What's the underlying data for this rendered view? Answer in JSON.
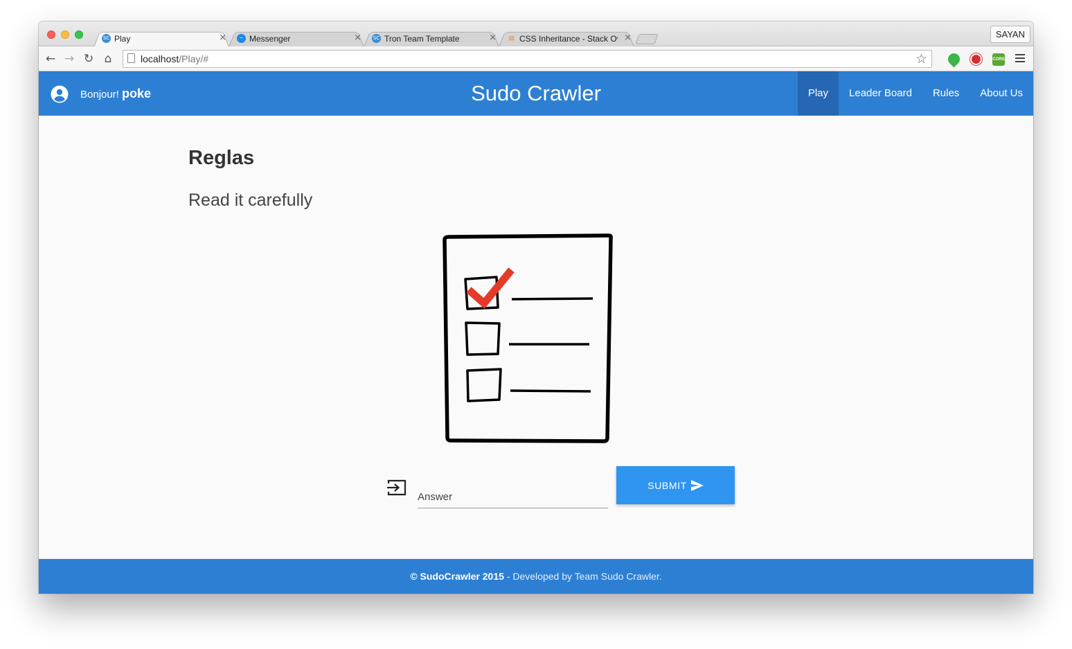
{
  "browser": {
    "tabs": [
      {
        "title": "Play",
        "favicon": "sc-icon",
        "active": true
      },
      {
        "title": "Messenger",
        "favicon": "messenger-icon",
        "active": false
      },
      {
        "title": "Tron Team Template",
        "favicon": "sc-icon",
        "active": false
      },
      {
        "title": "CSS Inheritance - Stack Ov",
        "favicon": "stackoverflow-icon",
        "active": false
      }
    ],
    "profile_name": "SAYAN",
    "url_host": "localhost",
    "url_path": "/Play/#"
  },
  "header": {
    "greeting": "Bonjour!",
    "username": "poke",
    "site_title": "Sudo Crawler",
    "nav": [
      {
        "label": "Play",
        "active": true
      },
      {
        "label": "Leader Board",
        "active": false
      },
      {
        "label": "Rules",
        "active": false
      },
      {
        "label": "About Us",
        "active": false
      }
    ]
  },
  "main": {
    "heading": "Reglas",
    "subheading": "Read it carefully",
    "answer_placeholder": "Answer",
    "submit_label": "SUBMIT"
  },
  "footer": {
    "copyright": "© SudoCrawler 2015",
    "credit": " - Developed by Team Sudo Crawler."
  },
  "colors": {
    "primary": "#2d7fd3",
    "nav_active": "#2567b3",
    "submit": "#2f95f0",
    "check": "#e53a2a"
  }
}
